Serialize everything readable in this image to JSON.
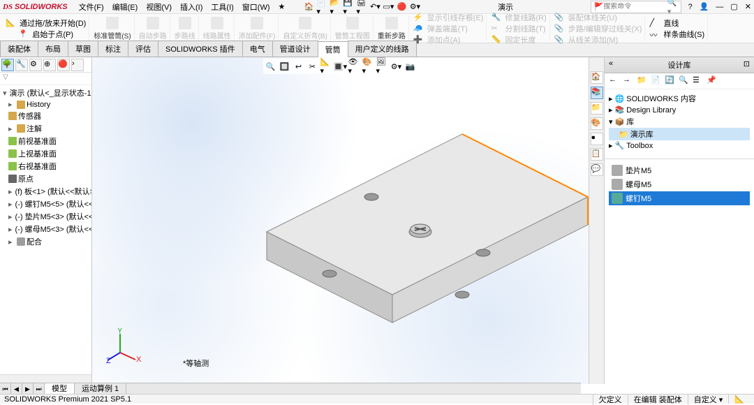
{
  "app": {
    "name": "SOLIDWORKS",
    "title": "演示"
  },
  "menu": {
    "file": "文件(F)",
    "edit": "编辑(E)",
    "view": "视图(V)",
    "insert": "插入(I)",
    "tools": "工具(I)",
    "window": "窗口(W)"
  },
  "search": {
    "placeholder": "搜索命令"
  },
  "ribbon": {
    "g1a": "通过拖/放来开始(D)",
    "g1b": "启始于点(P)",
    "g2": "标准管筒(S)",
    "g3": "自动步路",
    "g4": "步路线",
    "g5": "线路属性",
    "g6": "添加配件(F)",
    "g7": "自定义折弯(B)",
    "g8": "管筒工程图",
    "g9": "重新步路",
    "r1a": "显示引线存根(E)",
    "r1b": "弹盖端盖(T)",
    "r1c": "添加点(A)",
    "r2a": "修复线路(R)",
    "r2b": "分割线路(T)",
    "r2c": "固定长度",
    "r3a": "装配体线关(U)",
    "r3b": "步路/编辑穿过线关(X)",
    "r3c": "从线关添加(M)",
    "gl1": "直线",
    "gl2": "样条曲线(S)"
  },
  "tabs": {
    "t1": "装配体",
    "t2": "布局",
    "t3": "草图",
    "t4": "标注",
    "t5": "评估",
    "t6": "SOLIDWORKS 插件",
    "t7": "电气",
    "t8": "管道设计",
    "t9": "管筒",
    "t10": "用户定义的线路"
  },
  "feature_tree": {
    "filter_hint": "▽",
    "root": "演示  (默认<_显示状态-1",
    "history": "History",
    "sensors": "传感器",
    "annotations": "注解",
    "front": "前视基准面",
    "top": "上视基准面",
    "right": "右视基准面",
    "origin": "原点",
    "p1": "(f) 板<1> (默认<<默认>_显",
    "p2": "(-) 螺钉M5<5> (默认<<默",
    "p3": "(-) 垫片M5<3> (默认<<默",
    "p4": "(-) 螺母M5<3> (默认<<默",
    "mates": "配合"
  },
  "viewport": {
    "orientation": "*等轴测"
  },
  "design_library": {
    "title": "设计库",
    "tree": {
      "root": "SOLIDWORKS 内容",
      "dl": "Design Library",
      "lib": "库",
      "demo": "演示库",
      "toolbox": "Toolbox"
    },
    "items": {
      "i1": "垫片M5",
      "i2": "螺母M5",
      "i3": "螺钉M5"
    }
  },
  "bottom_tabs": {
    "t1": "模型",
    "t2": "运动算例 1"
  },
  "status": {
    "version": "SOLIDWORKS Premium 2021 SP5.1",
    "s1": "欠定义",
    "s2": "在编辑 装配体",
    "s3": "自定义"
  }
}
